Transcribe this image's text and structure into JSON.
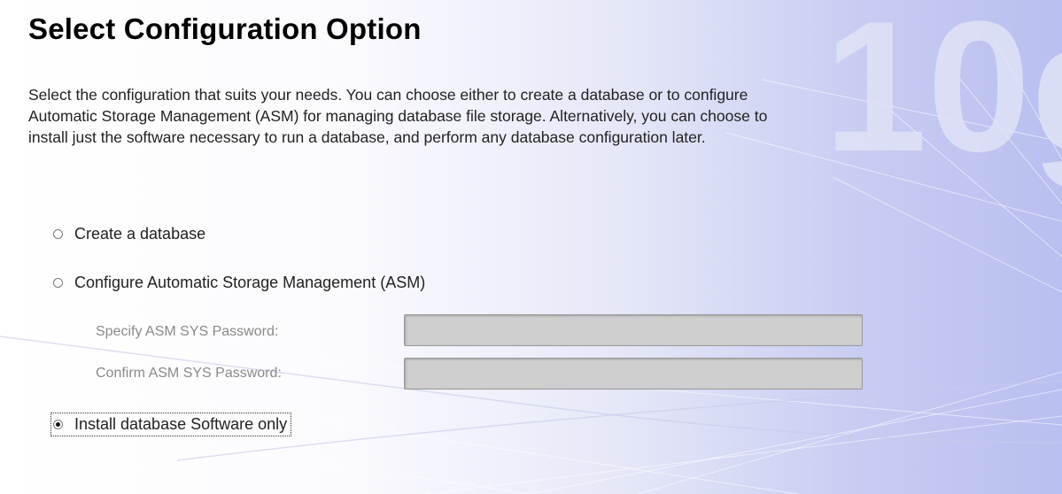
{
  "header": {
    "title": "Select Configuration Option",
    "description": [
      "Select the configuration that suits your needs. You can choose either to create a database or to configure",
      "Automatic Storage Management (ASM) for managing database file storage. Alternatively, you can choose to",
      "install just the software necessary to run a database, and perform any database configuration later."
    ]
  },
  "options": {
    "create_database": {
      "label": "Create a database",
      "selected": false
    },
    "configure_asm": {
      "label": "Configure Automatic Storage Management (ASM)",
      "selected": false
    },
    "install_software_only": {
      "label": "Install database Software only",
      "selected": true
    }
  },
  "asm": {
    "password_label": "Specify ASM SYS Password:",
    "password_value": "",
    "confirm_label": "Confirm ASM SYS Password:",
    "confirm_value": ""
  },
  "background": {
    "watermark": "10g",
    "colors": {
      "left": "#ffffff",
      "right": "#b9bff0",
      "watermark": "#dfe2f7"
    }
  }
}
